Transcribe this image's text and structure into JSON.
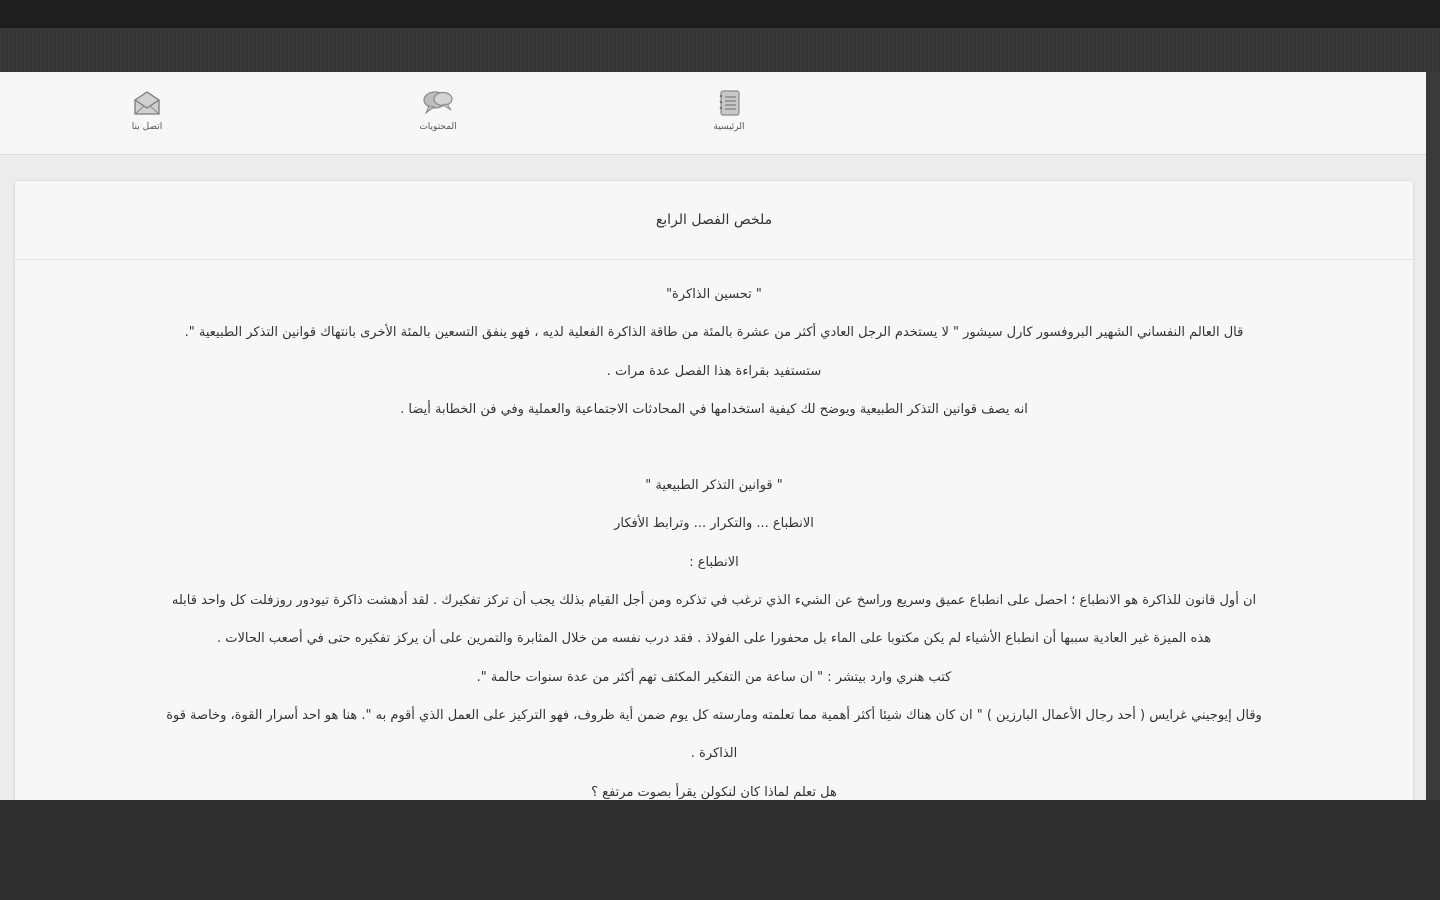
{
  "nav": {
    "items": [
      {
        "label": "الرئيسية",
        "icon": "notebook-icon"
      },
      {
        "label": "المحتويات",
        "icon": "chat-bubbles-icon"
      },
      {
        "label": "اتصل بنا",
        "icon": "envelope-icon"
      }
    ]
  },
  "card": {
    "title": "ملخص الفصل الرابع"
  },
  "content": {
    "lines": [
      "\" تحسين الذاكرة\"",
      "قال العالم النفساني الشهير البروفسور كارل سيشور \" لا يستخدم الرجل العادي أكثر من عشرة بالمئة من طاقة الذاكرة الفعلية لديه ، فهو ينفق التسعين بالمئة الأخرى بانتهاك قوانين التذكر الطبيعية \".",
      "ستستفيد بقراءة هذا الفصل عدة مرات .",
      "انه يصف قوانين التذكر الطبيعية ويوضح لك كيفية استخدامها في المحادثات الاجتماعية والعملية وفي فن الخطابة أيضا .",
      "",
      "\" قوانين التذكر الطبيعية \"",
      "الانطباع ... والتكرار ... وترابط الأفكار",
      "الانطباع :",
      "ان أول قانون للذاكرة هو الانطباع ؛ احصل على انطباع عميق وسريع وراسخ عن الشيء الذي ترغب في تذكره ومن أجل القيام بذلك يجب أن تركز تفكيرك . لقد أدهشت ذاكرة تيودور روزفلت كل واحد قابله",
      "هذه الميزة غير العادية سببها أن انطباع الأشياء لم يكن مكتوبا على الماء بل محفورا على الفولاذ . فقد درب نفسه من خلال المثابرة والتمرين على أن يركز تفكيره حتى في أصعب الحالات .",
      "كتب هنري وارد بيتشر : \" ان ساعة من التفكير المكثف تهم أكثر من عدة سنوات حالمة \".",
      "وقال إيوجيني غرايس ( أحد رجال الأعمال البارزين ) \" ان كان هناك شيئا أكثر أهمية مما تعلمته ومارسته كل يوم ضمن أية ظروف، فهو التركيز على العمل الذي أقوم به \". هنا هو احد أسرار القوة، وخاصة قوة",
      "الذاكرة .",
      "هل تعلم لماذا كان لنكولن يقرأ بصوت مرتفع ؟"
    ]
  }
}
